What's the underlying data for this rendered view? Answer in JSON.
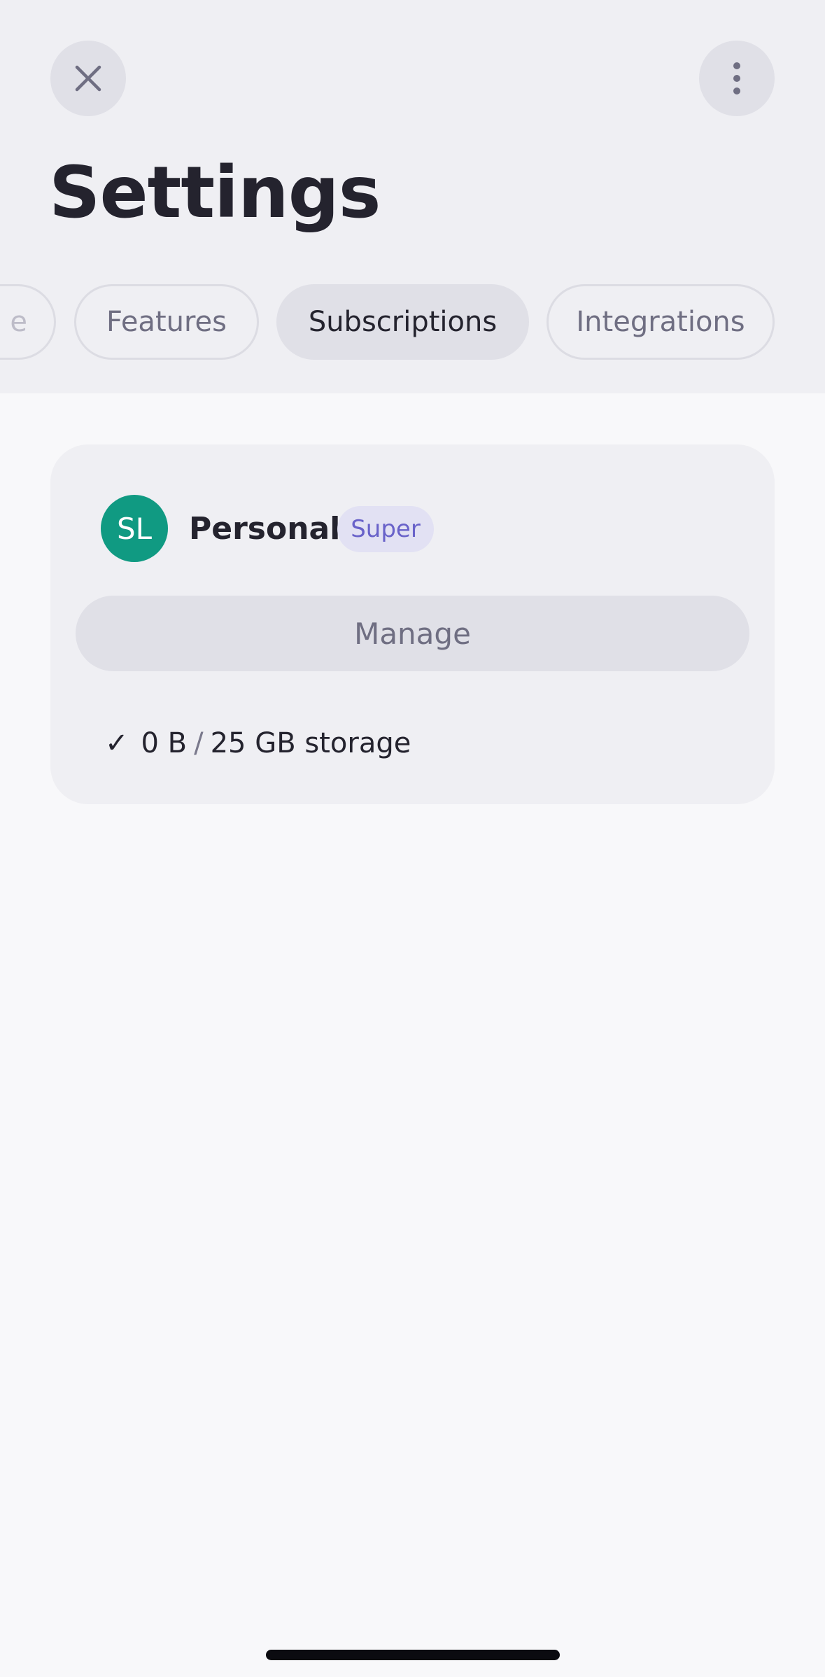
{
  "header": {
    "title": "Settings",
    "close_icon": "close-icon",
    "more_icon": "more-vertical-icon"
  },
  "tabs": [
    {
      "label": "e",
      "active": false
    },
    {
      "label": "Features",
      "active": false
    },
    {
      "label": "Subscriptions",
      "active": true
    },
    {
      "label": "Integrations",
      "active": false
    }
  ],
  "subscription": {
    "avatar_initials": "SL",
    "avatar_color": "#109a82",
    "plan_name": "Personal",
    "badge": "Super",
    "manage_label": "Manage",
    "storage": {
      "check_icon": "✓",
      "used": "0 B",
      "separator": "/",
      "total": "25 GB storage"
    }
  },
  "colors": {
    "header_bg": "#efeff3",
    "page_bg": "#f8f8fa",
    "accent_badge": "#6962c9"
  }
}
